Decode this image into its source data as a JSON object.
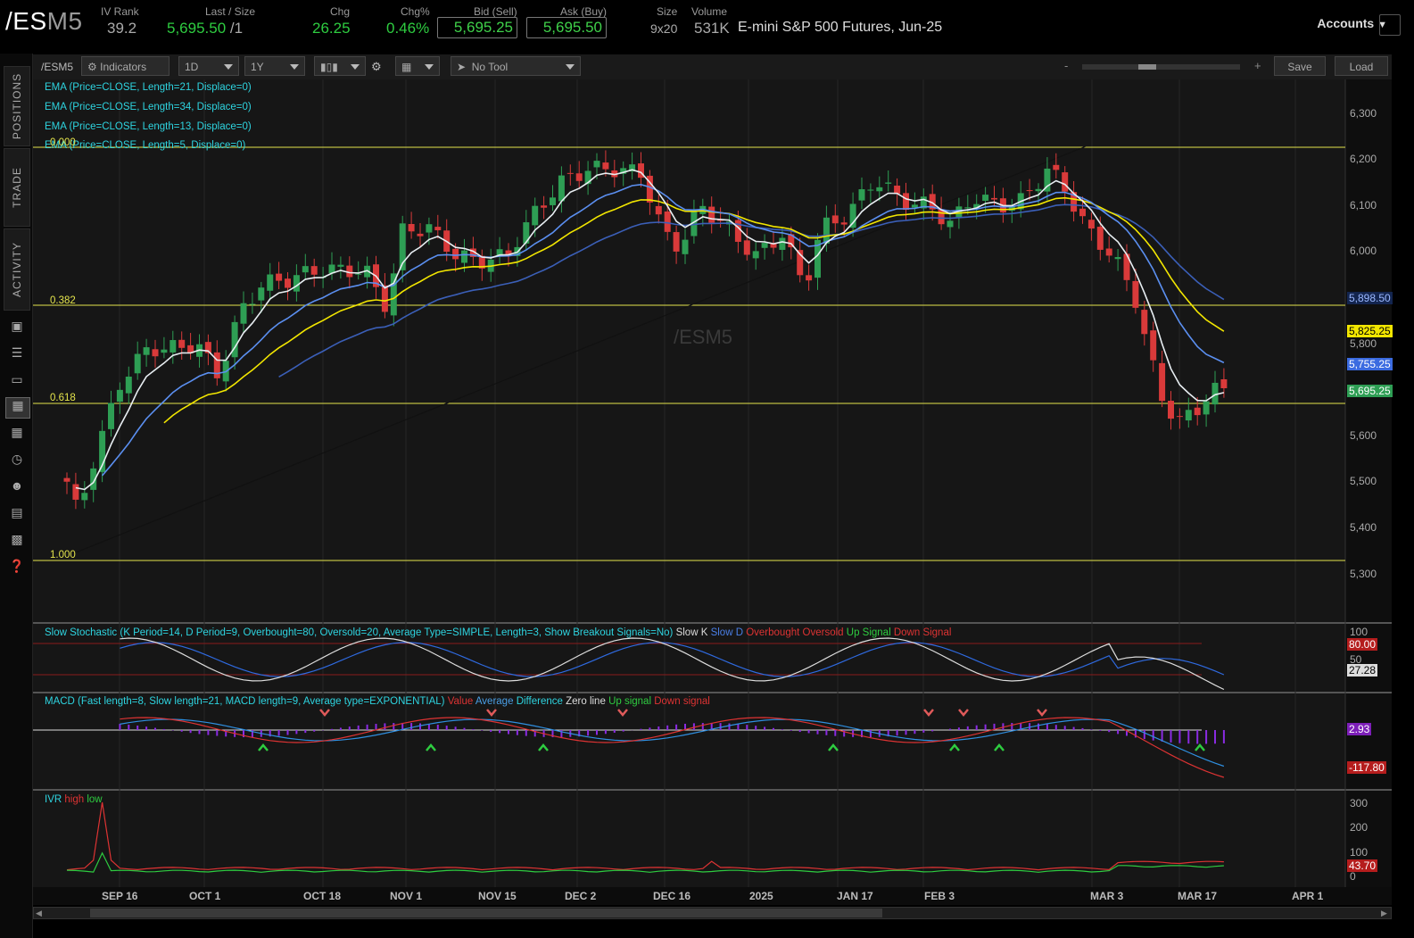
{
  "header": {
    "symbol_main": "/ES",
    "symbol_suffix": "M5",
    "iv_rank_label": "IV Rank",
    "iv_rank": "39.2",
    "last_label": "Last / Size",
    "last": "5,695.50",
    "last_size": "/1",
    "chg_label": "Chg",
    "chg": "26.25",
    "chgpct_label": "Chg%",
    "chgpct": "0.46%",
    "bid_label": "Bid (Sell)",
    "bid": "5,695.25",
    "ask_label": "Ask (Buy)",
    "ask": "5,695.50",
    "size_label": "Size",
    "size": "9x20",
    "volume_label": "Volume",
    "volume": "531K",
    "description": "E-mini S&P 500 Futures, Jun-25",
    "accounts": "Accounts"
  },
  "sidebar": {
    "tabs": [
      "POSITIONS",
      "TRADE",
      "ACTIVITY"
    ]
  },
  "toolbar": {
    "symbol": "/ESM5",
    "indicators": "Indicators",
    "aggregation": "1D",
    "range": "1Y",
    "tool": "No Tool",
    "zoom_minus": "-",
    "zoom_plus": "+",
    "save": "Save",
    "load": "Load"
  },
  "chart": {
    "watermark": "/ESM5",
    "studies": [
      "EMA (Price=CLOSE, Length=21, Displace=0)",
      "EMA (Price=CLOSE, Length=34, Displace=0)",
      "EMA (Price=CLOSE, Length=13, Displace=0)",
      "EMA (Price=CLOSE, Length=5, Displace=0)"
    ],
    "fib_levels": [
      "0.000",
      "0.382",
      "0.618",
      "1.000"
    ],
    "price_axis": [
      "6,300",
      "6,200",
      "6,100",
      "6,000",
      "5,800",
      "5,600",
      "5,500",
      "5,400",
      "5,300"
    ],
    "badges": {
      "ema34": "5,898.50",
      "ema21": "5,825.25",
      "ema13": "5,755.25",
      "last": "5,695.25"
    },
    "colors": {
      "up": "#2e9e54",
      "down": "#d93a3a",
      "ema5": "#e8eef2",
      "ema13": "#5b8ff0",
      "ema21": "#f2e600",
      "ema34": "#3b5fb8",
      "fib": "#e4e44c"
    }
  },
  "stochastic": {
    "title": "Slow Stochastic (K Period=14, D Period=9, Overbought=80, Oversold=20, Average Type=SIMPLE, Length=3, Show Breakout Signals=No)",
    "legend": [
      "Slow K",
      "Slow D",
      "Overbought",
      "Oversold",
      "Up Signal",
      "Down Signal"
    ],
    "axis": [
      "100",
      "50"
    ],
    "badge_ob": "80.00",
    "badge_k": "27.28"
  },
  "macd": {
    "title": "MACD (Fast length=8, Slow length=21, MACD length=9, Average type=EXPONENTIAL)",
    "legend": [
      "Value",
      "Average",
      "Difference",
      "Zero line",
      "Up signal",
      "Down signal"
    ],
    "badge_diff": "2.93",
    "badge_value": "-117.80"
  },
  "ivr": {
    "title": "IVR",
    "legend": [
      "high",
      "low"
    ],
    "axis": [
      "300",
      "200",
      "100",
      "0"
    ],
    "badge": "43.70"
  },
  "dates": [
    "SEP 16",
    "OCT 1",
    "OCT 18",
    "NOV 1",
    "NOV 15",
    "DEC 2",
    "DEC 16",
    "2025",
    "JAN 17",
    "FEB 3",
    "MAR 3",
    "MAR 17",
    "APR 1"
  ]
}
